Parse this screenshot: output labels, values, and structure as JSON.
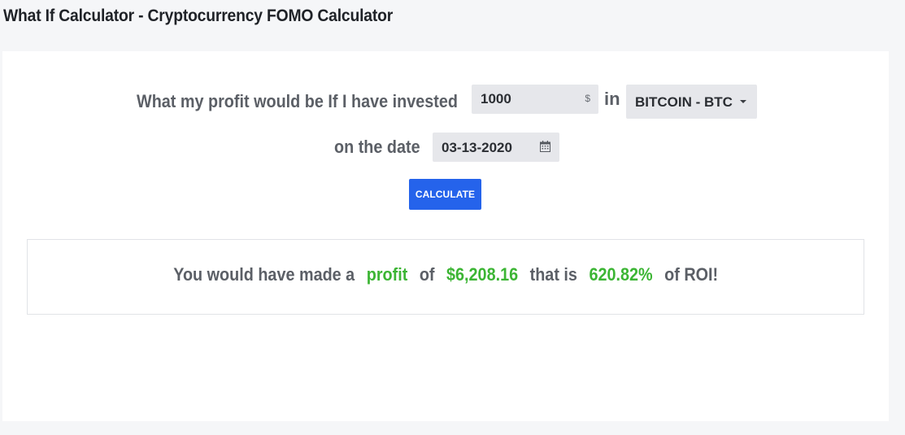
{
  "page": {
    "title": "What If Calculator - Cryptocurrency FOMO Calculator"
  },
  "form": {
    "question_label": "What my profit would be If I have invested",
    "amount_value": "1000",
    "currency_symbol": "$",
    "in_label": "in",
    "coin_selected": "BITCOIN - BTC",
    "date_label": "on the date",
    "date_value": "03-13-2020",
    "calculate_label": "CALCULATE"
  },
  "result": {
    "prefix": "You would have made a",
    "kind": "profit",
    "of_label": "of",
    "amount": "$6,208.16",
    "that_is_label": "that is",
    "roi_percent": "620.82%",
    "suffix": "of ROI!"
  },
  "colors": {
    "accent_button": "#2563eb",
    "positive": "#3cb534",
    "label_text": "#5b5f66"
  },
  "icons": {
    "date": "calendar-icon",
    "select": "caret-down-icon"
  }
}
